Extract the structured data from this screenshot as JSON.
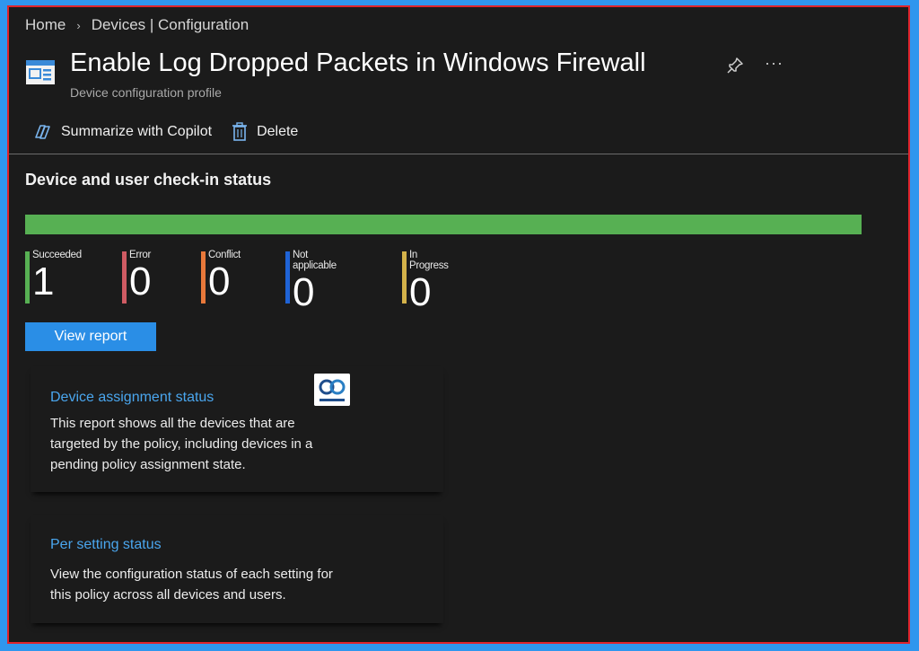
{
  "breadcrumb": {
    "home": "Home",
    "current": "Devices | Configuration"
  },
  "header": {
    "title": "Enable Log Dropped Packets in Windows Firewall",
    "subtitle": "Device configuration profile"
  },
  "toolbar": {
    "copilot_label": "Summarize with Copilot",
    "delete_label": "Delete"
  },
  "checkin": {
    "title": "Device and user check-in status",
    "progress_succeeded_fraction": 1.0,
    "stats": [
      {
        "label": "Succeeded",
        "value": "1",
        "color": "#57b053"
      },
      {
        "label": "Error",
        "value": "0",
        "color": "#cf5b63"
      },
      {
        "label": "Conflict",
        "value": "0",
        "color": "#e8783a"
      },
      {
        "label": "Not applicable",
        "value": "0",
        "color": "#1f63d6"
      },
      {
        "label": "In Progress",
        "value": "0",
        "color": "#d4b24a"
      }
    ],
    "view_report_label": "View report"
  },
  "reports": [
    {
      "title": "Device assignment status",
      "description": "This report shows all the devices that are targeted by the policy, including devices in a pending policy assignment state."
    },
    {
      "title": "Per setting status",
      "description": "View the configuration status of each setting for this policy across all devices and users."
    }
  ],
  "colors": {
    "accent": "#2a8ee6",
    "link": "#4aa6ee",
    "background": "#1b1b1b"
  }
}
